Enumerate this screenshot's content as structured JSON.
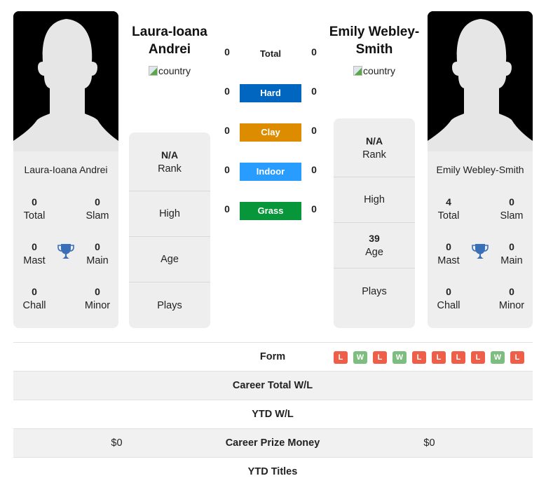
{
  "player_left": {
    "name": "Laura-Ioana Andrei",
    "heading_line1": "Laura-Ioana",
    "heading_line2": "Andrei",
    "country_alt": "country",
    "titles": {
      "total": {
        "value": "0",
        "label": "Total"
      },
      "slam": {
        "value": "0",
        "label": "Slam"
      },
      "mast": {
        "value": "0",
        "label": "Mast"
      },
      "main": {
        "value": "0",
        "label": "Main"
      },
      "chall": {
        "value": "0",
        "label": "Chall"
      },
      "minor": {
        "value": "0",
        "label": "Minor"
      }
    },
    "info": {
      "rank": {
        "value": "N/A",
        "label": "Rank"
      },
      "high": {
        "value": "",
        "label": "High"
      },
      "age": {
        "value": "",
        "label": "Age"
      },
      "plays": {
        "value": "",
        "label": "Plays"
      }
    }
  },
  "player_right": {
    "name": "Emily Webley-Smith",
    "heading_line1": "Emily Webley-",
    "heading_line2": "Smith",
    "country_alt": "country",
    "titles": {
      "total": {
        "value": "4",
        "label": "Total"
      },
      "slam": {
        "value": "0",
        "label": "Slam"
      },
      "mast": {
        "value": "0",
        "label": "Mast"
      },
      "main": {
        "value": "0",
        "label": "Main"
      },
      "chall": {
        "value": "0",
        "label": "Chall"
      },
      "minor": {
        "value": "0",
        "label": "Minor"
      }
    },
    "info": {
      "rank": {
        "value": "N/A",
        "label": "Rank"
      },
      "high": {
        "value": "",
        "label": "High"
      },
      "age": {
        "value": "39",
        "label": "Age"
      },
      "plays": {
        "value": "",
        "label": "Plays"
      }
    }
  },
  "h2h": [
    {
      "surface": "Total",
      "left": "0",
      "right": "0",
      "color": ""
    },
    {
      "surface": "Hard",
      "left": "0",
      "right": "0",
      "color": "#0066bf"
    },
    {
      "surface": "Clay",
      "left": "0",
      "right": "0",
      "color": "#dd8c00"
    },
    {
      "surface": "Indoor",
      "left": "0",
      "right": "0",
      "color": "#289cff"
    },
    {
      "surface": "Grass",
      "left": "0",
      "right": "0",
      "color": "#07963a"
    }
  ],
  "comparison": {
    "form": {
      "label": "Form",
      "results": [
        "L",
        "W",
        "L",
        "W",
        "L",
        "L",
        "L",
        "L",
        "W",
        "L"
      ]
    },
    "career_total_wl": {
      "label": "Career Total W/L",
      "left": "",
      "right": ""
    },
    "ytd_wl": {
      "label": "YTD W/L",
      "left": "",
      "right": ""
    },
    "career_prize_money": {
      "label": "Career Prize Money",
      "left": "$0",
      "right": "$0"
    },
    "ytd_titles": {
      "label": "YTD Titles",
      "left": "",
      "right": ""
    }
  },
  "colors": {
    "trophy": "#3a6fb8",
    "loss": "#ee5e49",
    "win": "#7dbd7f"
  }
}
